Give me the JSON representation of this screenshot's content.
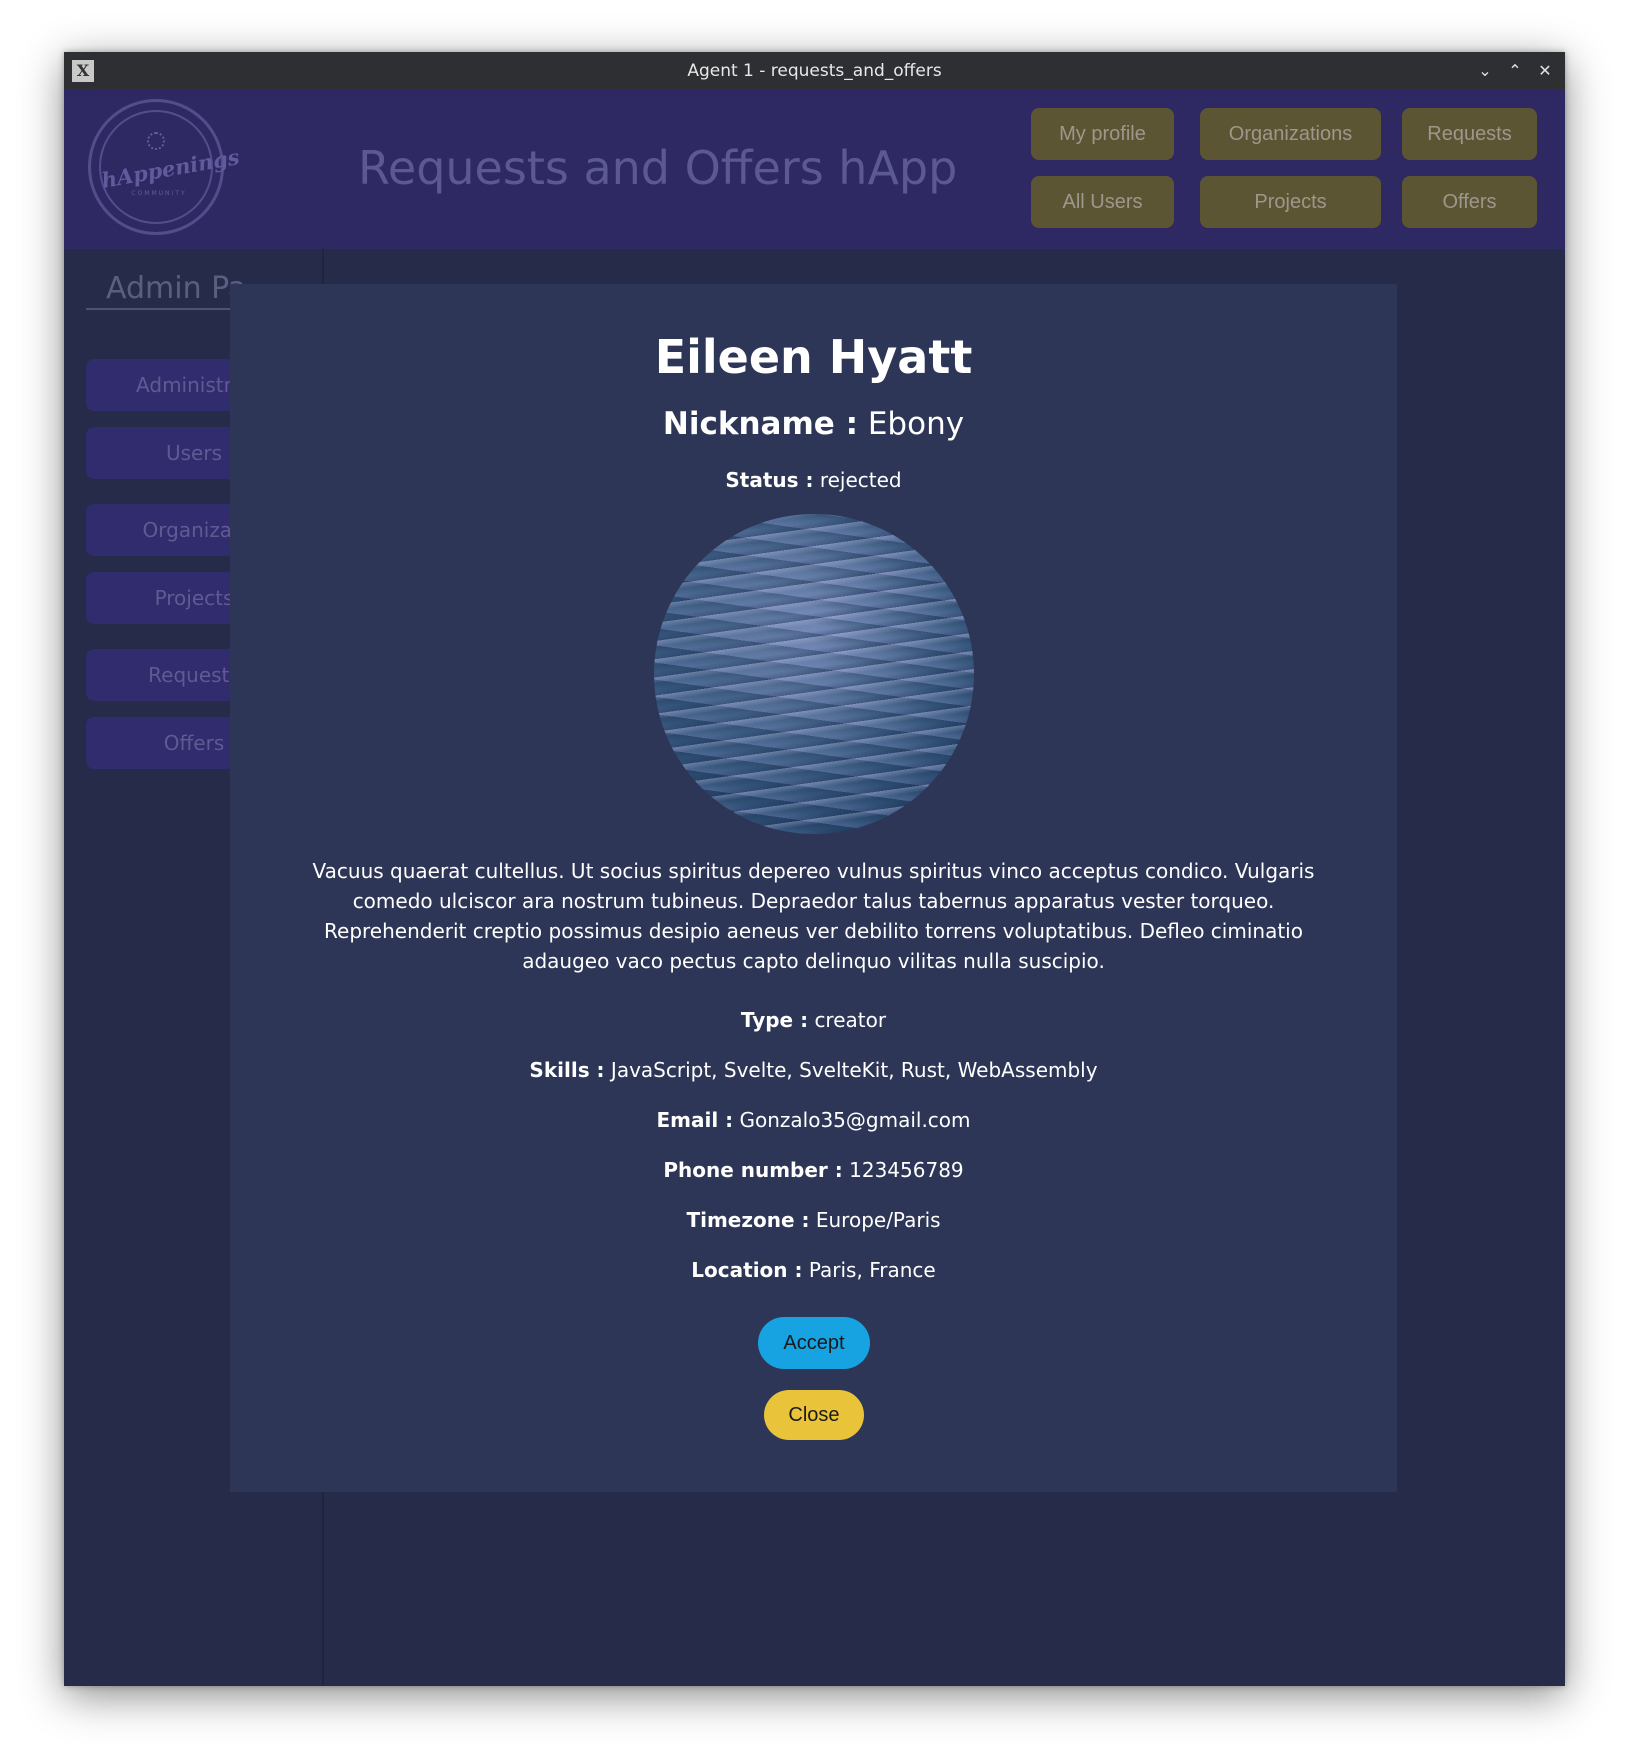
{
  "window": {
    "title": "Agent 1 - requests_and_offers"
  },
  "header": {
    "app_title": "Requests and Offers hApp",
    "logo_text": "hAppenings",
    "logo_subtext": "COMMUNITY",
    "nav": {
      "my_profile": "My profile",
      "organizations": "Organizations",
      "requests": "Requests",
      "all_users": "All Users",
      "projects": "Projects",
      "offers": "Offers"
    }
  },
  "sidebar": {
    "title": "Admin Pa",
    "items": [
      "Administrat",
      "Users",
      "Organizati",
      "Projects",
      "Requests",
      "Offers"
    ]
  },
  "modal": {
    "name": "Eileen Hyatt",
    "nickname_label": "Nickname :",
    "nickname": "Ebony",
    "status_label": "Status :",
    "status": "rejected",
    "bio": "Vacuus quaerat cultellus. Ut socius spiritus depereo vulnus spiritus vinco acceptus condico. Vulgaris comedo ulciscor ara nostrum tubineus. Depraedor talus tabernus apparatus vester torqueo. Reprehenderit creptio possimus desipio aeneus ver debilito torrens voluptatibus. Defleo ciminatio adaugeo vaco pectus capto delinquo vilitas nulla suscipio.",
    "type_label": "Type :",
    "type": "creator",
    "skills_label": "Skills :",
    "skills": "JavaScript, Svelte, SvelteKit, Rust, WebAssembly",
    "email_label": "Email :",
    "email": "Gonzalo35@gmail.com",
    "phone_label": "Phone number :",
    "phone": "123456789",
    "timezone_label": "Timezone :",
    "timezone": "Europe/Paris",
    "location_label": "Location :",
    "location": "Paris, France",
    "accept_label": "Accept",
    "close_label": "Close"
  }
}
